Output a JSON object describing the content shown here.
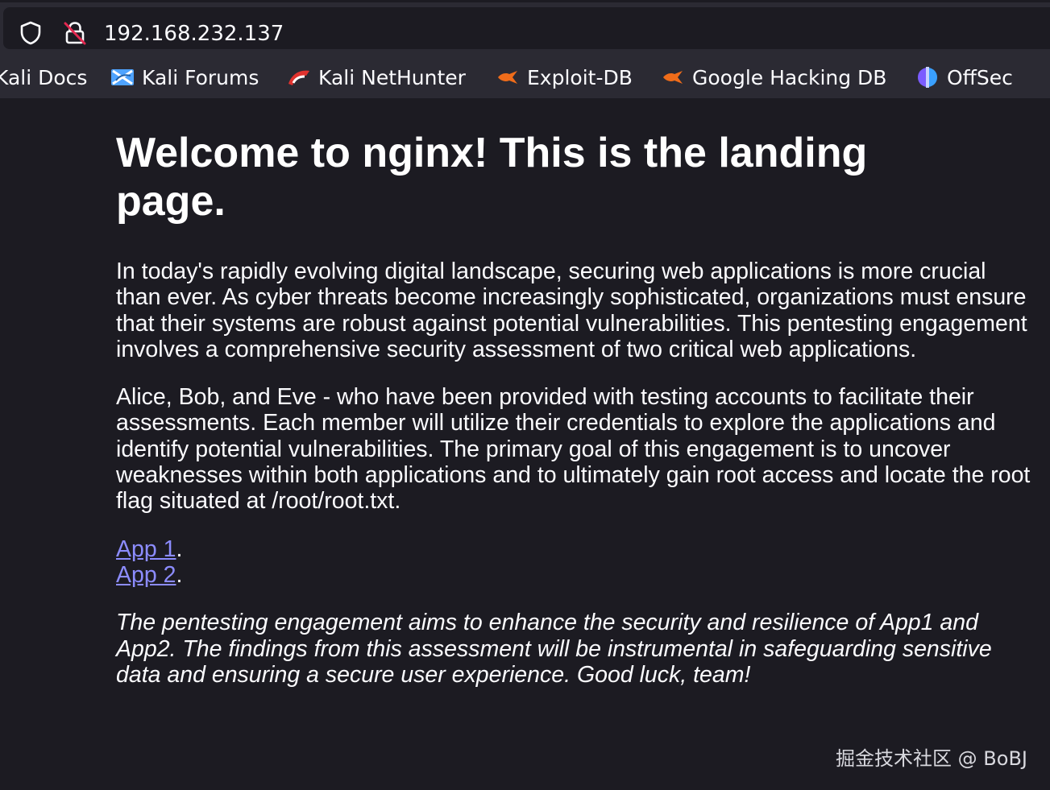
{
  "browser": {
    "url": "192.168.232.137",
    "bookmarks": [
      {
        "label": "Kali Docs",
        "icon": "kali-docs-icon"
      },
      {
        "label": "Kali Forums",
        "icon": "kali-forums-icon"
      },
      {
        "label": "Kali NetHunter",
        "icon": "kali-nethunter-icon"
      },
      {
        "label": "Exploit-DB",
        "icon": "exploit-db-icon"
      },
      {
        "label": "Google Hacking DB",
        "icon": "google-hacking-db-icon"
      },
      {
        "label": "OffSec",
        "icon": "offsec-icon"
      }
    ]
  },
  "page": {
    "title": "Welcome to nginx! This is the landing page.",
    "paragraph1": "In today's rapidly evolving digital landscape, securing web applications is more crucial than ever. As cyber threats become increasingly sophisticated, organizations must ensure that their systems are robust against potential vulnerabilities. This pentesting engagement involves a comprehensive security assessment of two critical web applications.",
    "paragraph2": "Alice, Bob, and Eve - who have been provided with testing accounts to facilitate their assessments. Each member will utilize their credentials to explore the applications and identify potential vulnerabilities. The primary goal of this engagement is to uncover weaknesses within both applications and to ultimately gain root access and locate the root flag situated at /root/root.txt.",
    "links": [
      {
        "label": "App 1",
        "suffix": "."
      },
      {
        "label": "App 2",
        "suffix": "."
      }
    ],
    "closing": "The pentesting engagement aims to enhance the security and resilience of App1 and App2. The findings from this assessment will be instrumental in safeguarding sensitive data and ensuring a secure user experience. Good luck, team!"
  },
  "watermark": "掘金技术社区 @ BoBJ",
  "colors": {
    "background": "#1c1b22",
    "toolbar": "#2b2a33",
    "text": "#fbfbfe",
    "link": "#8c8cff",
    "insecure_slash": "#e22850"
  }
}
